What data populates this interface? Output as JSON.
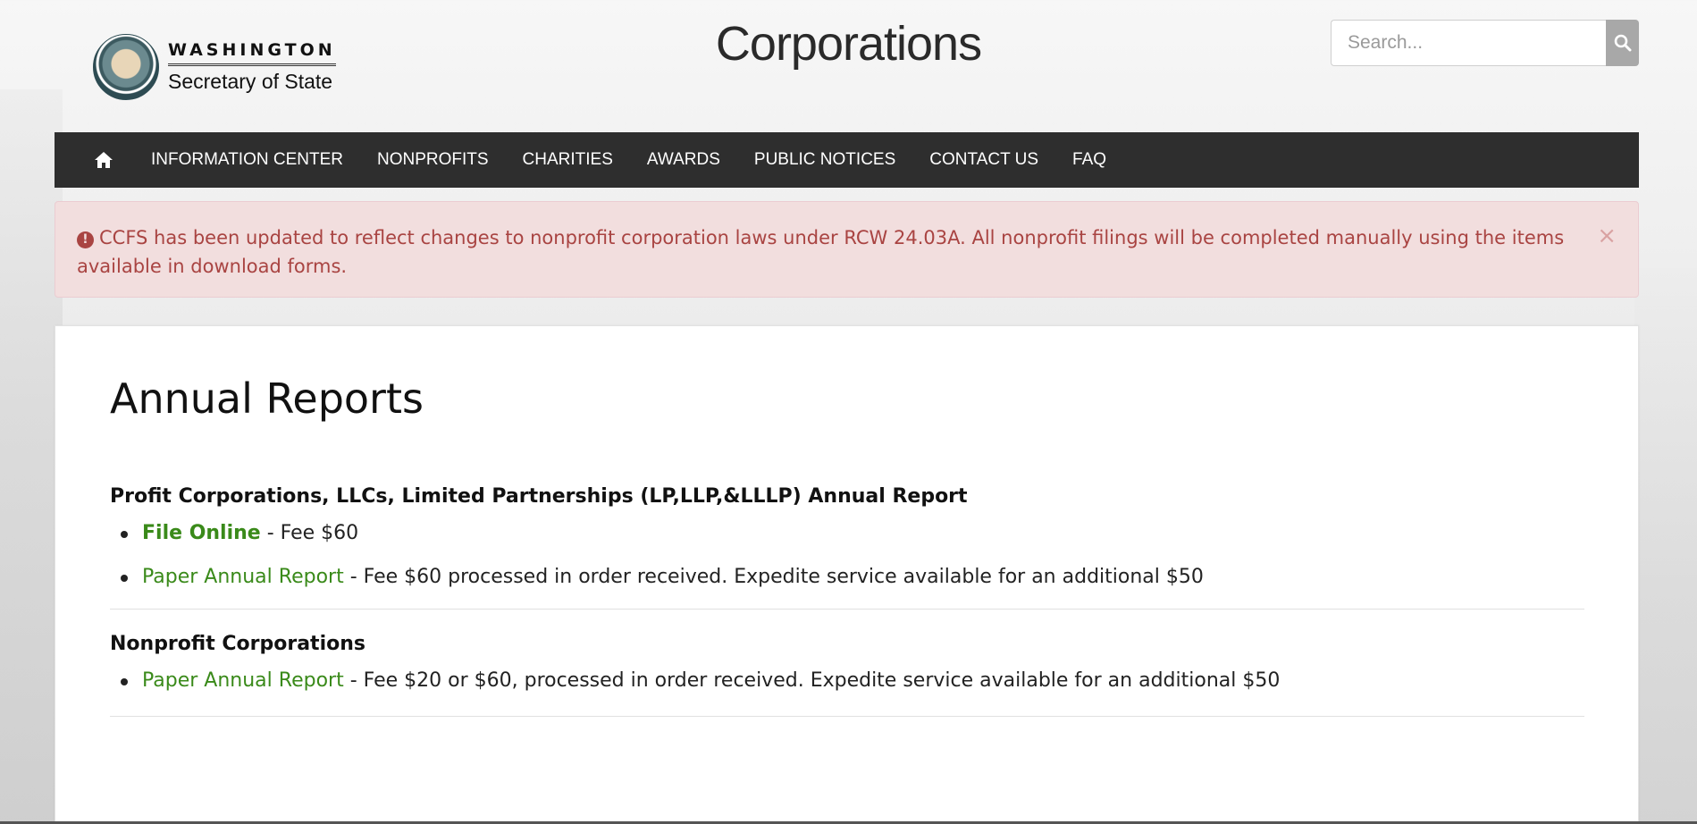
{
  "header": {
    "logo_state": "WASHINGTON",
    "logo_subtitle": "Secretary of State",
    "page_title": "Corporations",
    "search_placeholder": "Search..."
  },
  "nav": {
    "home_icon": "home-icon",
    "items": [
      "INFORMATION CENTER",
      "NONPROFITS",
      "CHARITIES",
      "AWARDS",
      "PUBLIC NOTICES",
      "CONTACT US",
      "FAQ"
    ]
  },
  "alert": {
    "icon": "exclamation-circle-icon",
    "message": "CCFS has been updated to reflect changes to nonprofit corporation laws under RCW 24.03A. All nonprofit filings will be completed manually using the items available in download forms.",
    "close": "×"
  },
  "main": {
    "heading": "Annual Reports",
    "sections": [
      {
        "title": "Profit Corporations, LLCs, Limited Partnerships (LP,LLP,&LLLP) Annual Report",
        "items": [
          {
            "link": "File Online",
            "text": " - Fee $60"
          },
          {
            "link": "Paper Annual Report",
            "text": " - Fee $60 processed in order received. Expedite service available for an additional $50"
          }
        ]
      },
      {
        "title": "Nonprofit Corporations",
        "items": [
          {
            "link": "Paper Annual Report",
            "text": " - Fee $20 or $60, processed in order received. Expedite service available for an additional $50"
          }
        ]
      }
    ]
  },
  "colors": {
    "nav_bg": "#2e2e2e",
    "alert_bg": "#f2dede",
    "alert_text": "#a94442",
    "link_green": "#3a8a1a"
  }
}
